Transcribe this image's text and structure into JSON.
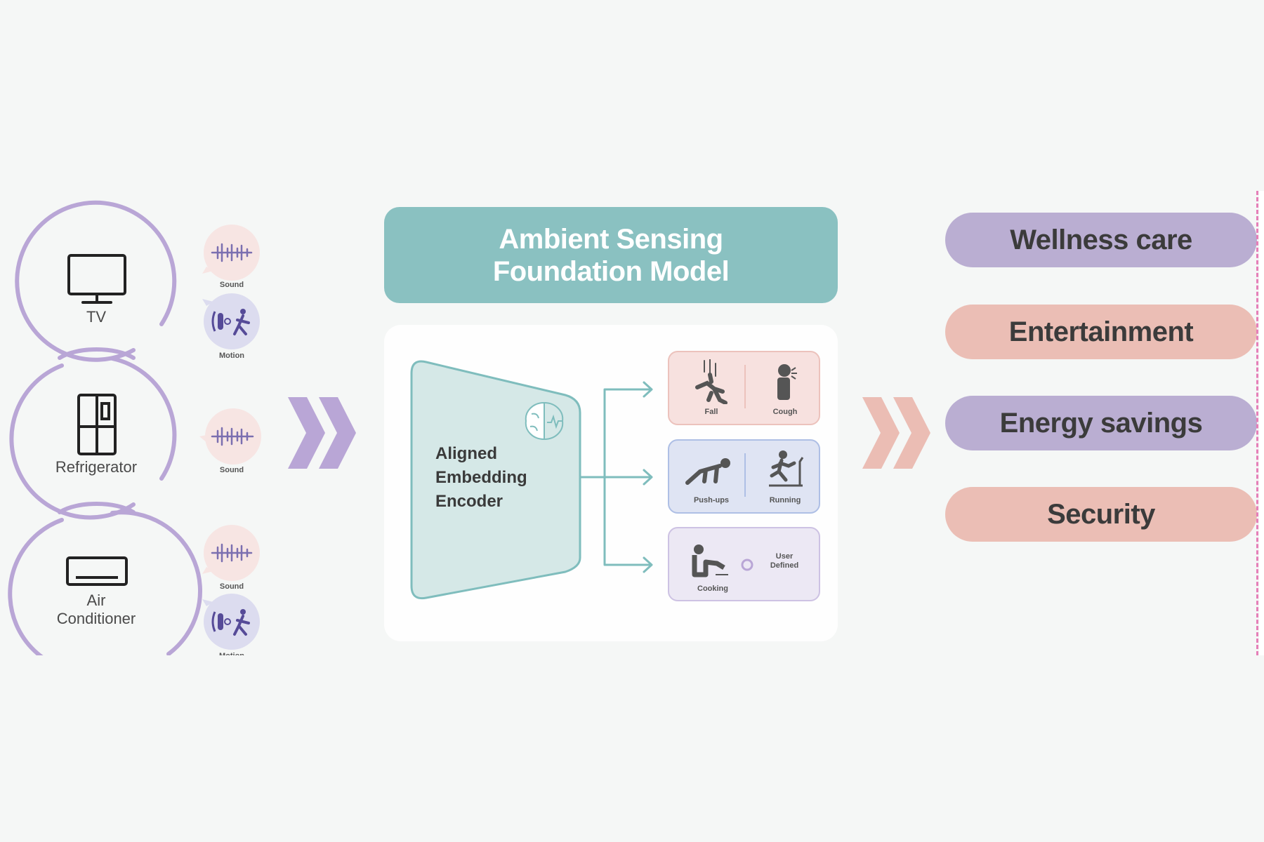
{
  "colors": {
    "background": "#f5f7f6",
    "device_ring": "#b9a6d6",
    "sound_bubble": "#f7e5e3",
    "motion_bubble": "#dcdcef",
    "icon_purple": "#6e64a8",
    "teal": "#8ac1c1",
    "teal_light": "#d5e8e7",
    "teal_stroke": "#7fbdbd",
    "chevron_purple": "#b9a6d6",
    "chevron_pink": "#ebbdb4",
    "pill_purple": "#baaed2",
    "pill_pink": "#ebbeb5",
    "card_pink_bg": "#f7e1df",
    "card_pink_border": "#ecc2bc",
    "card_blue_bg": "#dfe4f3",
    "card_blue_border": "#aebfe5",
    "card_lav_bg": "#ece8f4",
    "card_lav_border": "#cdc2e3",
    "dash_line": "#e57fb8"
  },
  "devices": [
    {
      "name": "TV",
      "icon": "tv-icon",
      "sensors": [
        {
          "label": "Sound",
          "icon": "sound-wave-icon"
        },
        {
          "label": "Motion",
          "icon": "motion-icon"
        }
      ]
    },
    {
      "name": "Refrigerator",
      "icon": "refrigerator-icon",
      "sensors": [
        {
          "label": "Sound",
          "icon": "sound-wave-icon"
        }
      ]
    },
    {
      "name_lines": [
        "Air",
        "Conditioner"
      ],
      "icon": "air-conditioner-icon",
      "sensors": [
        {
          "label": "Sound",
          "icon": "sound-wave-icon"
        },
        {
          "label": "Motion",
          "icon": "motion-icon"
        }
      ]
    }
  ],
  "model": {
    "title_lines": [
      "Ambient Sensing",
      "Foundation Model"
    ],
    "encoder_lines": [
      "Aligned",
      "Embedding",
      "Encoder"
    ],
    "encoder_icon": "brain-icon"
  },
  "tasks": [
    {
      "items": [
        {
          "label": "Fall",
          "icon": "fall-icon"
        },
        {
          "label": "Cough",
          "icon": "cough-icon"
        }
      ]
    },
    {
      "items": [
        {
          "label": "Push-ups",
          "icon": "push-ups-icon"
        },
        {
          "label": "Running",
          "icon": "running-icon"
        }
      ]
    },
    {
      "items": [
        {
          "label": "Cooking",
          "icon": "cooking-icon"
        },
        {
          "label_lines": [
            "User",
            "Defined"
          ],
          "icon": "plus-circle-icon"
        }
      ]
    }
  ],
  "outcomes": [
    {
      "label": "Wellness care",
      "tone": "purple"
    },
    {
      "label": "Entertainment",
      "tone": "pink"
    },
    {
      "label": "Energy savings",
      "tone": "purple"
    },
    {
      "label": "Security",
      "tone": "pink"
    }
  ]
}
